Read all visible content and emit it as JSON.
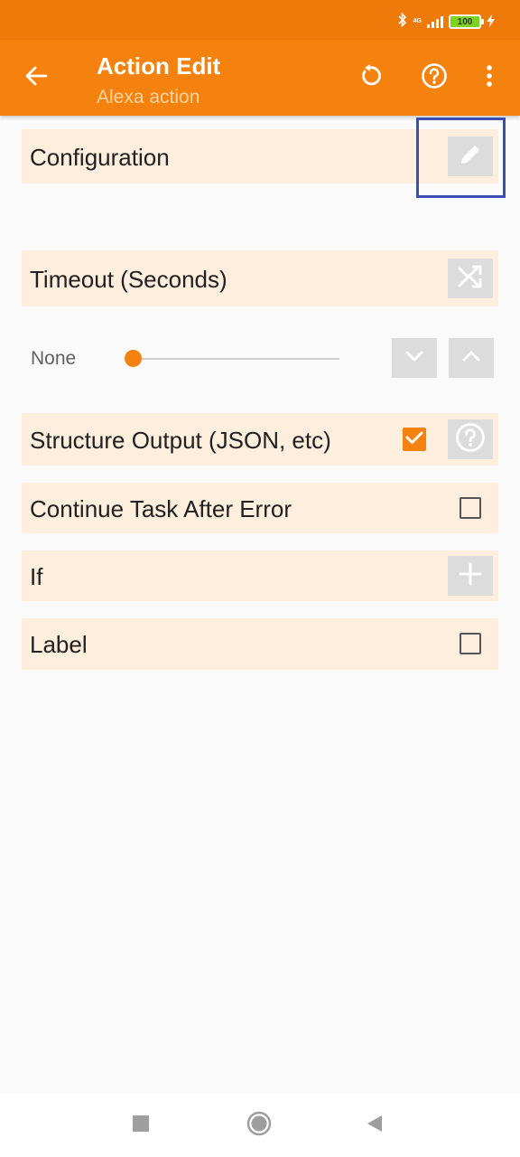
{
  "status_bar": {
    "network_label": "4G",
    "battery_level": "100"
  },
  "app_bar": {
    "title": "Action Edit",
    "subtitle": "Alexa action"
  },
  "rows": {
    "configuration": {
      "label": "Configuration"
    },
    "timeout": {
      "label": "Timeout (Seconds)"
    },
    "timeout_slider": {
      "value_label": "None",
      "position": 0
    },
    "structure_output": {
      "label": "Structure Output (JSON, etc)",
      "checked": true
    },
    "continue_after_error": {
      "label": "Continue Task After Error",
      "checked": false
    },
    "if": {
      "label": "If"
    },
    "label": {
      "label": "Label",
      "checked": false
    }
  },
  "colors": {
    "status_bar": "#ee7a0a",
    "app_bar": "#f5820f",
    "row_background": "#fdeedd",
    "accent": "#f5820f",
    "icon_button_bg": "#dcdcdc",
    "highlight": "#3c4fb0"
  },
  "icons": {
    "back": "arrow-left-icon",
    "reset": "undo-icon",
    "help": "help-circle-icon",
    "more": "more-vert-icon",
    "edit": "pencil-icon",
    "random": "shuffle-icon",
    "decrease": "chevron-down-icon",
    "increase": "chevron-up-icon",
    "structure_help": "help-circle-icon",
    "add": "plus-icon",
    "nav_recents": "square-icon",
    "nav_home": "circle-icon",
    "nav_back": "triangle-back-icon"
  }
}
